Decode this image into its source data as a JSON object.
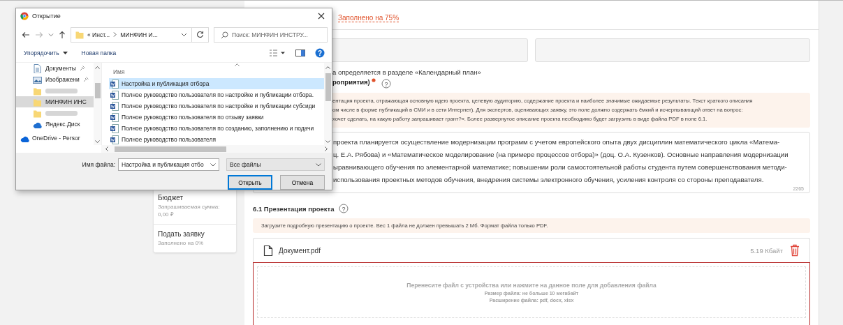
{
  "header": {
    "progress_text": "Заполнено на 75%"
  },
  "fields": [
    {
      "kind": "input"
    },
    {
      "kind": "input"
    }
  ],
  "hint": "а определяется в разделе «Календарный план»",
  "section_label": {
    "text": "роприятия)",
    "required": true,
    "help": "?"
  },
  "note_lines": [
    "ентация проекта, отражающая основную идею проекта, целевую аудиторию, содержание проекта и наиболее значимые ожидаемые результаты. Текст краткого описания",
    "ом числе в форме публикаций в СМИ и в сети Интернет). Для экспертов, оценивающих заявку, это поле должно содержать ёмкий и исчерпывающий ответ на вопрос:",
    "хочет сделать, на какую работу запрашивает грант?». Более развернутое описание проекта необходимо будет загрузить в виде файла PDF в поле 6.1."
  ],
  "textarea_lines": [
    "проекта планируется осуществление модернизации программ с учетом европейского опыта двух дисциплин математического цикла «Матема-",
    "ц. Е.А. Рябова) и «Математическое моделирование (на примере процессов отбора)» (доц. О.А. Кузенков). Основные направления модернизации",
    "ыравнивающего обучения по элементарной математике; повышении роли самостоятельной работы студента путем совершенствования методи-",
    "использования проектных методов обучения, внедрения системы электронного обучения, усиления контроля со стороны преподавателя."
  ],
  "char_count": "2265",
  "presentation": {
    "title": "6.1 Презентация проекта",
    "help": "?",
    "note": "Загрузите подробную презентацию о проекте. Вес 1 файла не должен превышать 2 Мб. Формат файла только PDF.",
    "file": {
      "name": "Документ.pdf",
      "size": "5.19 Кбайт"
    },
    "dropzone": {
      "main": "Перенесите файл с устройства или нажмите на данное поле для добавления файла",
      "size": "Размер файла: не больше 10 мегабайт",
      "ext": "Расширение файла: pdf, docx, xlsx",
      "error": true
    }
  },
  "sidebar": {
    "items": [
      {
        "title": "Бюджет",
        "sub": [
          "Запрашиваемая сумма:",
          "0,00 ₽"
        ]
      },
      {
        "title": "Подать заявку",
        "sub": [
          "Заполнено на 0%"
        ]
      }
    ]
  },
  "dialog": {
    "title": "Открытие",
    "path": [
      "« Инст...",
      "МИНФИН И..."
    ],
    "search_placeholder": "Поиск: МИНФИН ИНСТРУ...",
    "toolbar": [
      "Упорядочить",
      "Новая папка"
    ],
    "help": "?",
    "tree": [
      {
        "kind": "docs",
        "label": "Документы",
        "pinned": true,
        "selected": false
      },
      {
        "kind": "images",
        "label": "Изображени",
        "pinned": true,
        "selected": false
      },
      {
        "kind": "blurred",
        "selected": false
      },
      {
        "kind": "folder",
        "label": "МИНФИН ИНС",
        "pinned": false,
        "selected": true
      },
      {
        "kind": "blurred",
        "selected": false
      },
      {
        "kind": "cloud",
        "label": "Яндекс.Диск",
        "pinned": false,
        "selected": false
      },
      {
        "kind": "onedrive",
        "label": "OneDrive - Persor",
        "pinned": false,
        "selected": false
      }
    ],
    "column": "Имя",
    "files": [
      {
        "name": "Настройка и публикация отбора",
        "selected": true
      },
      {
        "name": "Полное руководство пользователя по настройке и публикации отбора.",
        "selected": false
      },
      {
        "name": "Полное руководство пользователя по настройке и публикации субсиди",
        "selected": false
      },
      {
        "name": "Полное руководство пользователя по отзыву заявки",
        "selected": false
      },
      {
        "name": "Полное руководство пользователя по созданию, заполнению и подачи",
        "selected": false
      },
      {
        "name": "Полное руководство пользователя",
        "selected": false
      }
    ],
    "filename_label": "Имя файла:",
    "filename": "Настройка и публикация отбо",
    "filetype": "Все файлы",
    "buttons": [
      "Открыть",
      "Отмена"
    ]
  }
}
